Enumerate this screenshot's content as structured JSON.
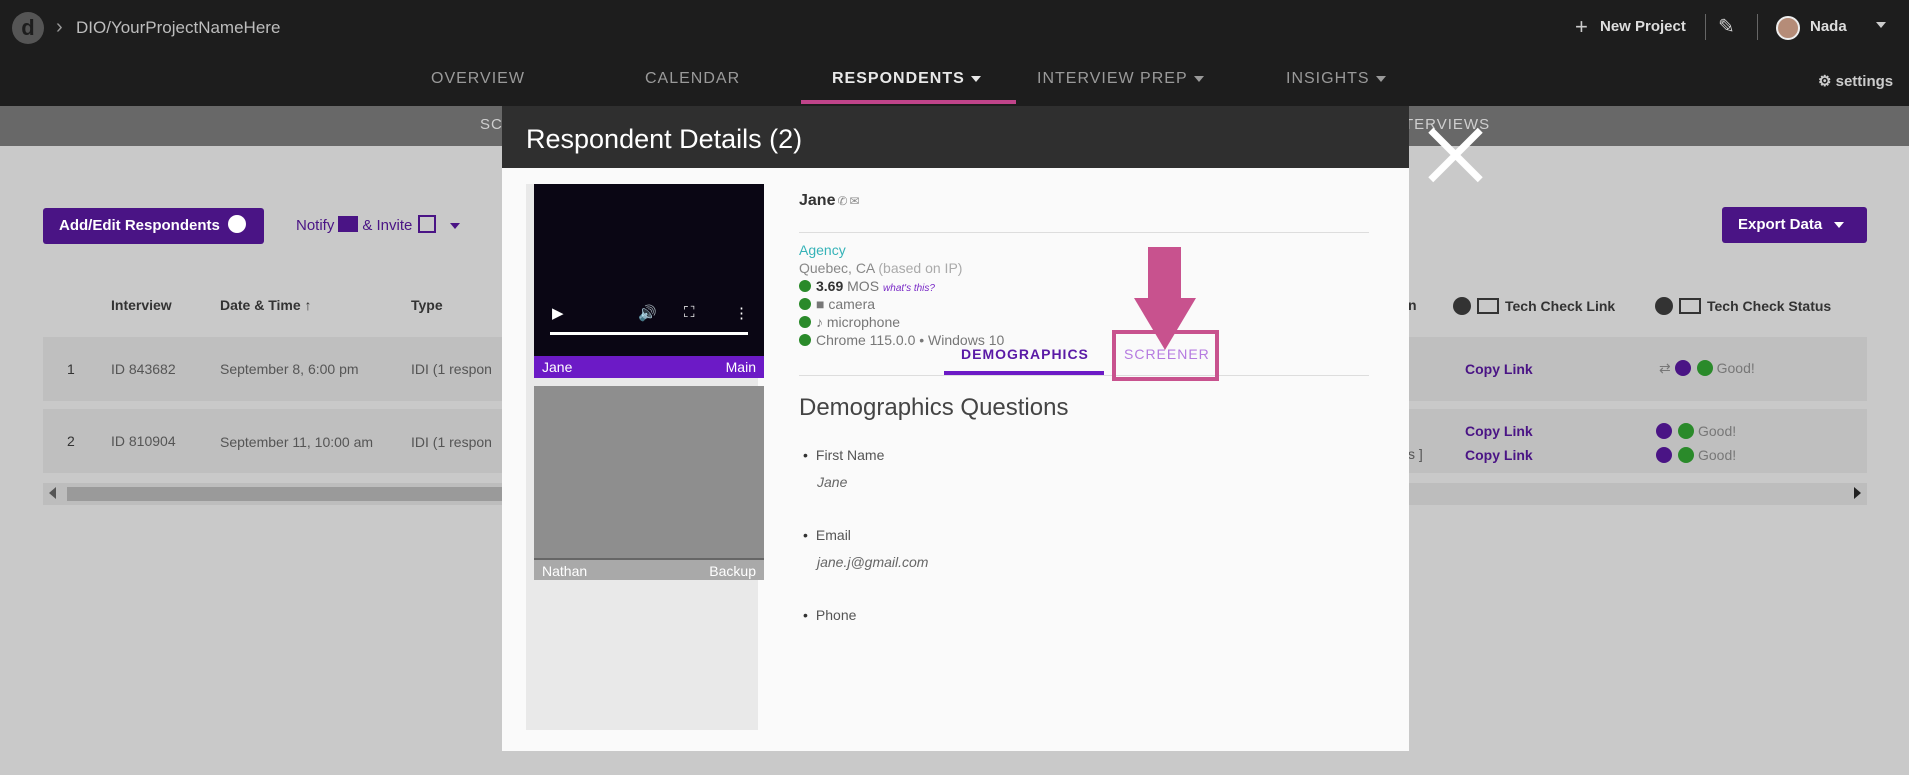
{
  "app": {
    "logo_letter": "d",
    "breadcrumb": "DIO/YourProjectNameHere",
    "new_project": "New Project",
    "user_name": "Nada",
    "settings": "settings"
  },
  "nav": {
    "overview": "OVERVIEW",
    "calendar": "CALENDAR",
    "respondents": "RESPONDENTS",
    "interview_prep": "INTERVIEW PREP",
    "insights": "INSIGHTS"
  },
  "subnav": {
    "left_fragment": "SC",
    "right_fragment": "TERVIEWS"
  },
  "toolbar": {
    "add_edit": "Add/Edit Respondents",
    "notify": "Notify",
    "invite": "& Invite",
    "export": "Export Data"
  },
  "table": {
    "headers": {
      "interview": "Interview",
      "datetime": "Date & Time ↑",
      "type": "Type",
      "tech_link": "Tech Check Link",
      "tech_status": "Tech Check Status"
    },
    "rows": [
      {
        "num": "1",
        "id": "ID 843682",
        "date": "September 8, 6:00 pm",
        "type": "IDI (1 respon",
        "link1": "Copy Link",
        "status1": "Good!"
      },
      {
        "num": "2",
        "id": "ID 810904",
        "date": "September 11, 10:00 am",
        "type": "IDI (1 respon",
        "link1": "Copy Link",
        "link2": "Copy Link",
        "status1": "Good!",
        "status2": "Good!",
        "fragment": "s ]"
      }
    ]
  },
  "modal": {
    "title": "Respondent Details (2)",
    "videos": [
      {
        "name": "Jane",
        "role": "Main"
      },
      {
        "name": "Nathan",
        "role": "Backup"
      }
    ],
    "respondent": {
      "name": "Jane",
      "agency": "Agency",
      "location": "Quebec, CA",
      "location_note": "(based on IP)",
      "mos": "3.69",
      "mos_label": "MOS",
      "whats_this": "what's this?",
      "camera": "camera",
      "microphone": "microphone",
      "system": "Chrome 115.0.0 • Windows 10"
    },
    "tabs": {
      "demographics": "DEMOGRAPHICS",
      "screener": "SCREENER"
    },
    "questions_title": "Demographics Questions",
    "questions": [
      {
        "label": "First Name",
        "answer": "Jane"
      },
      {
        "label": "Email",
        "answer": "jane.j@gmail.com"
      },
      {
        "label": "Phone",
        "answer": ""
      }
    ]
  },
  "colors": {
    "topbar": "#1d1d1d",
    "brand_purple": "#4a1485",
    "highlight_pink": "#c8528e",
    "tab_active": "#5a1aa6",
    "agency_teal": "#36b3b8"
  }
}
